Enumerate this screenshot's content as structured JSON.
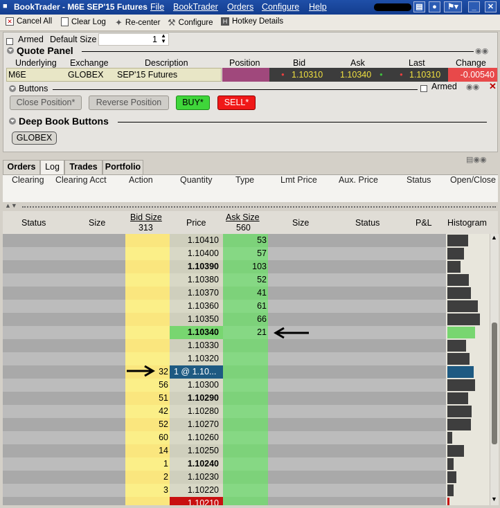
{
  "window": {
    "title": "BookTrader - M6E SEP'15 Futures",
    "menu": [
      "File",
      "BookTrader",
      "Orders",
      "Configure",
      "Help"
    ]
  },
  "toolbar": {
    "cancel_all": "Cancel All",
    "clear_log": "Clear Log",
    "recenter": "Re-center",
    "configure": "Configure",
    "hotkey": "Hotkey Details"
  },
  "settings": {
    "armed_label": "Armed",
    "default_size_label": "Default Size",
    "default_size_value": "1"
  },
  "quote_panel": {
    "title": "Quote Panel",
    "headers": [
      "Underlying",
      "Exchange",
      "Description",
      "Position",
      "Bid",
      "Ask",
      "Last",
      "Change"
    ],
    "row": {
      "underlying": "M6E",
      "exchange": "GLOBEX",
      "description": "SEP'15 Futures",
      "position": "",
      "bid": "1.10310",
      "ask": "1.10340",
      "last": "1.10310",
      "change": "-0.00540"
    }
  },
  "buttons_section": {
    "title": "Buttons",
    "armed_label": "Armed",
    "close_position": "Close Position*",
    "reverse_position": "Reverse Position",
    "buy": "BUY*",
    "sell": "SELL*"
  },
  "deep_book": {
    "title": "Deep Book Buttons",
    "globex": "GLOBEX"
  },
  "tabs": [
    "Orders",
    "Log",
    "Trades",
    "Portfolio"
  ],
  "orders_columns": [
    "Clearing",
    "Clearing Acct",
    "Action",
    "Quantity",
    "Type",
    "Lmt Price",
    "Aux. Price",
    "Status",
    "Open/Close"
  ],
  "book": {
    "headers": {
      "status_left": "Status",
      "size_left": "Size",
      "bid_size": "Bid Size",
      "bid_total": "313",
      "price": "Price",
      "ask_size": "Ask Size",
      "ask_total": "560",
      "size_right": "Size",
      "status_right": "Status",
      "pl": "P&L",
      "histogram": "Histogram"
    },
    "rows": [
      {
        "bid": "",
        "price": "1.10410",
        "ask": "53",
        "hist": 0.5,
        "bold": false
      },
      {
        "bid": "",
        "price": "1.10400",
        "ask": "57",
        "hist": 0.4,
        "bold": false
      },
      {
        "bid": "",
        "price": "1.10390",
        "ask": "103",
        "hist": 0.33,
        "bold": true
      },
      {
        "bid": "",
        "price": "1.10380",
        "ask": "52",
        "hist": 0.52,
        "bold": false
      },
      {
        "bid": "",
        "price": "1.10370",
        "ask": "41",
        "hist": 0.58,
        "bold": false
      },
      {
        "bid": "",
        "price": "1.10360",
        "ask": "61",
        "hist": 0.75,
        "bold": false
      },
      {
        "bid": "",
        "price": "1.10350",
        "ask": "66",
        "hist": 0.8,
        "bold": false
      },
      {
        "bid": "",
        "price": "1.10340",
        "ask": "21",
        "hist": 0.68,
        "bold": true,
        "askrow": true
      },
      {
        "bid": "",
        "price": "1.10330",
        "ask": "",
        "hist": 0.45,
        "bold": false
      },
      {
        "bid": "",
        "price": "1.10320",
        "ask": "",
        "hist": 0.55,
        "bold": false
      },
      {
        "bid": "32",
        "price": "1 @ 1.10...",
        "ask": "",
        "hist": 0.65,
        "bold": false,
        "order": true
      },
      {
        "bid": "56",
        "price": "1.10300",
        "ask": "",
        "hist": 0.68,
        "bold": false
      },
      {
        "bid": "51",
        "price": "1.10290",
        "ask": "",
        "hist": 0.5,
        "bold": true
      },
      {
        "bid": "42",
        "price": "1.10280",
        "ask": "",
        "hist": 0.6,
        "bold": false
      },
      {
        "bid": "52",
        "price": "1.10270",
        "ask": "",
        "hist": 0.58,
        "bold": false
      },
      {
        "bid": "60",
        "price": "1.10260",
        "ask": "",
        "hist": 0.12,
        "bold": false
      },
      {
        "bid": "14",
        "price": "1.10250",
        "ask": "",
        "hist": 0.4,
        "bold": false
      },
      {
        "bid": "1",
        "price": "1.10240",
        "ask": "",
        "hist": 0.15,
        "bold": true
      },
      {
        "bid": "2",
        "price": "1.10230",
        "ask": "",
        "hist": 0.22,
        "bold": false
      },
      {
        "bid": "3",
        "price": "1.10220",
        "ask": "",
        "hist": 0.16,
        "bold": false
      },
      {
        "bid": "",
        "price": "1.10210",
        "ask": "",
        "hist": 0.05,
        "bold": false,
        "last": true
      }
    ]
  },
  "colors": {
    "bid_col": "#fbf08c",
    "ask_col": "#7dd27a",
    "ask_bid_row_price": "#78d670",
    "order_cell": "#1e5a82",
    "change_bg": "#e8494a",
    "position_bg": "#a0487c"
  }
}
